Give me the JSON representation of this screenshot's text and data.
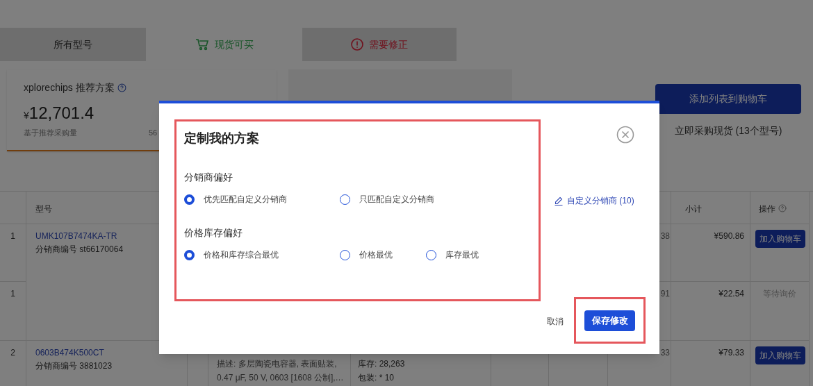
{
  "tabs": [
    {
      "label": "所有型号",
      "selected": false,
      "kind": "plain"
    },
    {
      "label": "现货可买",
      "selected": true,
      "kind": "cart"
    },
    {
      "label": "需要修正",
      "selected": false,
      "kind": "alert"
    }
  ],
  "summary": {
    "title": "xplorechips 推荐方案",
    "currency": "¥",
    "total": "12,701.4",
    "note": "基于推荐采购量",
    "note_2": "56"
  },
  "cart_button": "添加列表到购物车",
  "buy_note": "立即采购现货 (13个型号)",
  "table": {
    "columns": [
      "型号",
      "小计",
      "操作"
    ],
    "rows": [
      {
        "index": "1",
        "model": "UMK107B7474KA-TR",
        "distributor_no": "分销商编号 st66170064",
        "column_5": "38",
        "subtotal": "¥590.86",
        "action": {
          "kind": "button",
          "label": "加入购物车"
        }
      },
      {
        "index": "1",
        "column_5": "91",
        "subtotal": "¥22.54",
        "action": {
          "kind": "status",
          "label": "等待询价"
        }
      },
      {
        "index": "2",
        "model": "0603B474K500CT",
        "distributor_no": "分销商编号 3881023",
        "description": [
          "描述: 多层陶瓷电容器, 表面贴装,",
          "0.47 μF, 50 V, 0603 [1608 公制],…"
        ],
        "stock": [
          "库存: 28,263",
          "包装: * 10"
        ],
        "column_5": "33",
        "subtotal": "¥79.33",
        "action": {
          "kind": "button",
          "label": "加入购物车"
        }
      }
    ]
  },
  "dialog": {
    "title": "定制我的方案",
    "sections": [
      {
        "label": "分销商偏好",
        "options": [
          {
            "label": "优先匹配自定义分销商",
            "selected": true
          },
          {
            "label": "只匹配自定义分销商",
            "selected": false
          }
        ],
        "link": "自定义分销商 (10)"
      },
      {
        "label": "价格库存偏好",
        "options": [
          {
            "label": "价格和库存综合最优",
            "selected": true
          },
          {
            "label": "价格最优",
            "selected": false
          },
          {
            "label": "库存最优",
            "selected": false
          }
        ]
      }
    ],
    "cancel": "取消",
    "save": "保存修改"
  }
}
